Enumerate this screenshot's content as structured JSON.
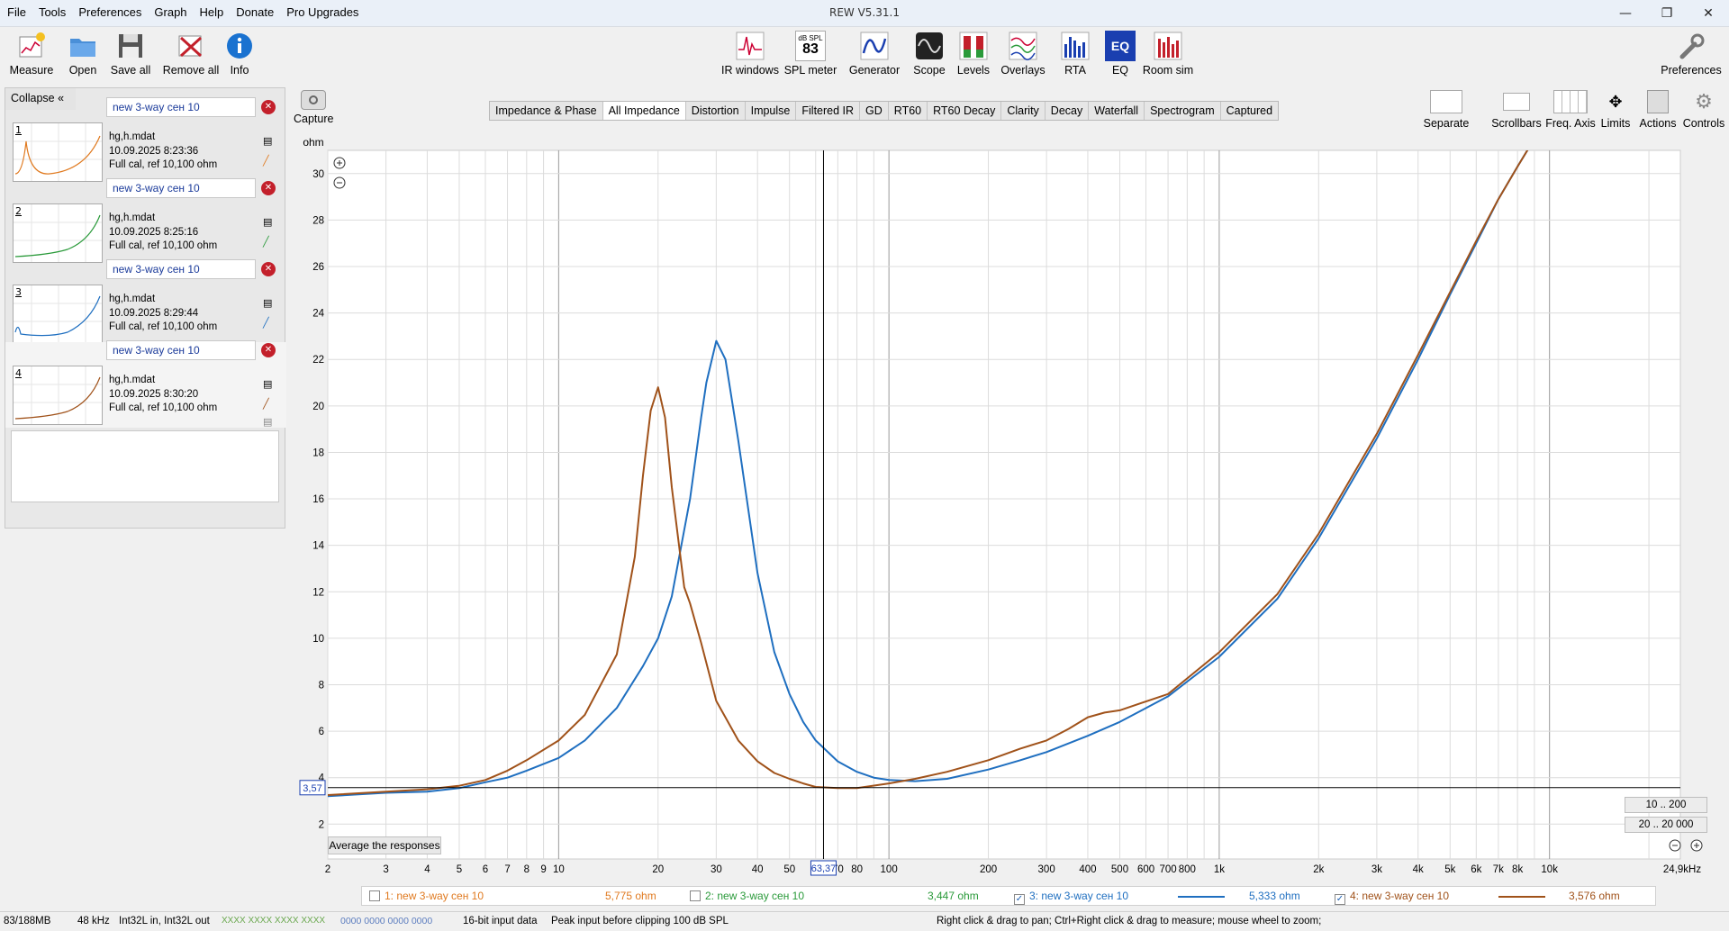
{
  "app": {
    "title": "REW V5.31.1",
    "menu": [
      "File",
      "Tools",
      "Preferences",
      "Graph",
      "Help",
      "Donate",
      "Pro Upgrades"
    ]
  },
  "toolbar_left": [
    {
      "label": "Measure",
      "icon": "measure-icon"
    },
    {
      "label": "Open",
      "icon": "folder-icon"
    },
    {
      "label": "Save all",
      "icon": "floppy-icon"
    },
    {
      "label": "Remove all",
      "icon": "remove-icon"
    },
    {
      "label": "Info",
      "icon": "info-icon"
    }
  ],
  "toolbar_center": [
    {
      "label": "IR windows",
      "icon": "ir-windows-icon"
    },
    {
      "label": "SPL meter",
      "icon": "spl-meter-icon",
      "badge_top": "dB SPL",
      "badge_value": "83"
    },
    {
      "label": "Generator",
      "icon": "generator-icon"
    },
    {
      "label": "Scope",
      "icon": "scope-icon"
    },
    {
      "label": "Levels",
      "icon": "levels-icon"
    },
    {
      "label": "Overlays",
      "icon": "overlays-icon"
    },
    {
      "label": "RTA",
      "icon": "rta-icon"
    },
    {
      "label": "EQ",
      "icon": "eq-icon"
    },
    {
      "label": "Room sim",
      "icon": "room-sim-icon"
    }
  ],
  "toolbar_right": {
    "label": "Preferences",
    "icon": "wrench-icon"
  },
  "panel": {
    "collapse_label": "Collapse",
    "measurements": [
      {
        "num": "1",
        "name": "new 3-way сен 10",
        "file": "hg,h.mdat",
        "date": "10.09.2025 8:23:36",
        "cal": "Full cal, ref 10,100 ohm",
        "color": "#e07a20",
        "thumb_x_start": "20",
        "thumb_x_end": "20,0k"
      },
      {
        "num": "2",
        "name": "new 3-way сен 10",
        "file": "hg,h.mdat",
        "date": "10.09.2025 8:25:16",
        "cal": "Full cal, ref 10,100 ohm",
        "color": "#2a9a3a",
        "thumb_x_start": "20",
        "thumb_x_end": "20,0k"
      },
      {
        "num": "3",
        "name": "new 3-way сен 10",
        "file": "hg,h.mdat",
        "date": "10.09.2025 8:29:44",
        "cal": "Full cal, ref 10,100 ohm",
        "color": "#1f6fc0",
        "thumb_x_start": "20",
        "thumb_x_end": "20,0k"
      },
      {
        "num": "4",
        "name": "new 3-way сен 10",
        "file": "hg,h.mdat",
        "date": "10.09.2025 8:30:20",
        "cal": "Full cal, ref 10,100 ohm",
        "color": "#a0521a",
        "thumb_x_start": "20",
        "thumb_x_end": "20,0k"
      }
    ]
  },
  "capture": {
    "label": "Capture"
  },
  "tabs": [
    "Impedance & Phase",
    "All Impedance",
    "Distortion",
    "Impulse",
    "Filtered IR",
    "GD",
    "RT60",
    "RT60 Decay",
    "Clarity",
    "Decay",
    "Waterfall",
    "Spectrogram",
    "Captured"
  ],
  "active_tab": "All Impedance",
  "graph_tools": [
    {
      "label": "Separate",
      "icon": "separate-icon"
    },
    {
      "label": "Scrollbars",
      "icon": "scrollbars-icon"
    },
    {
      "label": "Freq. Axis",
      "icon": "freq-axis-icon"
    },
    {
      "label": "Limits",
      "icon": "limits-icon"
    },
    {
      "label": "Actions",
      "icon": "actions-icon"
    },
    {
      "label": "Controls",
      "icon": "controls-icon"
    }
  ],
  "graph": {
    "y_unit": "ohm",
    "cursor_y_label": "3,57",
    "cursor_x_label": "63,37",
    "avg_button": "Average the responses",
    "range_buttons": [
      "10 .. 200",
      "20 .. 20 000"
    ],
    "x_end_label": "24,9kHz"
  },
  "chart_data": {
    "type": "line",
    "xscale": "log",
    "xlim": [
      2,
      24900
    ],
    "ylim": [
      0.5,
      31
    ],
    "ylabel": "ohm",
    "y_ticks": [
      2,
      4,
      6,
      8,
      10,
      12,
      14,
      16,
      18,
      20,
      22,
      24,
      26,
      28,
      30
    ],
    "x_ticks": [
      {
        "v": 2,
        "t": "2"
      },
      {
        "v": 3,
        "t": "3"
      },
      {
        "v": 4,
        "t": "4"
      },
      {
        "v": 5,
        "t": "5"
      },
      {
        "v": 6,
        "t": "6"
      },
      {
        "v": 7,
        "t": "7"
      },
      {
        "v": 8,
        "t": "8"
      },
      {
        "v": 9,
        "t": "9"
      },
      {
        "v": 10,
        "t": "10"
      },
      {
        "v": 20,
        "t": "20"
      },
      {
        "v": 30,
        "t": "30"
      },
      {
        "v": 40,
        "t": "40"
      },
      {
        "v": 50,
        "t": "50"
      },
      {
        "v": 70,
        "t": "70"
      },
      {
        "v": 80,
        "t": "80"
      },
      {
        "v": 100,
        "t": "100"
      },
      {
        "v": 200,
        "t": "200"
      },
      {
        "v": 300,
        "t": "300"
      },
      {
        "v": 400,
        "t": "400"
      },
      {
        "v": 500,
        "t": "500"
      },
      {
        "v": 600,
        "t": "600"
      },
      {
        "v": 700,
        "t": "700"
      },
      {
        "v": 800,
        "t": "800"
      },
      {
        "v": 1000,
        "t": "1k"
      },
      {
        "v": 2000,
        "t": "2k"
      },
      {
        "v": 3000,
        "t": "3k"
      },
      {
        "v": 4000,
        "t": "4k"
      },
      {
        "v": 5000,
        "t": "5k"
      },
      {
        "v": 6000,
        "t": "6k"
      },
      {
        "v": 7000,
        "t": "7k"
      },
      {
        "v": 8000,
        "t": "8k"
      },
      {
        "v": 10000,
        "t": "10k"
      }
    ],
    "cursor": {
      "x": 63.37,
      "y": 3.57
    },
    "series": [
      {
        "name": "3: new 3-way сен 10",
        "color": "#1f6fc0",
        "x": [
          2,
          3,
          4,
          5,
          6,
          7,
          8,
          10,
          12,
          15,
          18,
          20,
          22,
          25,
          27,
          28,
          30,
          32,
          35,
          40,
          45,
          50,
          55,
          60,
          70,
          80,
          90,
          100,
          120,
          150,
          200,
          250,
          300,
          400,
          500,
          700,
          1000,
          1500,
          2000,
          3000,
          4000,
          5000,
          6000,
          7000,
          8000,
          9000,
          10000
        ],
        "y": [
          3.2,
          3.35,
          3.4,
          3.55,
          3.8,
          4.0,
          4.3,
          4.85,
          5.6,
          7.0,
          8.8,
          10.0,
          11.8,
          16.0,
          19.5,
          21.0,
          22.8,
          22.0,
          18.5,
          12.8,
          9.4,
          7.6,
          6.4,
          5.6,
          4.7,
          4.25,
          4.0,
          3.9,
          3.85,
          3.95,
          4.35,
          4.75,
          5.1,
          5.8,
          6.4,
          7.5,
          9.2,
          11.7,
          14.3,
          18.6,
          22.0,
          24.8,
          27.0,
          28.9,
          30.3,
          31.5,
          32.5
        ]
      },
      {
        "name": "4: new 3-way сен 10",
        "color": "#a0521a",
        "x": [
          2,
          3,
          4,
          5,
          6,
          7,
          8,
          10,
          12,
          15,
          17,
          18,
          19,
          20,
          21,
          22,
          24,
          25,
          27,
          30,
          35,
          40,
          45,
          50,
          55,
          60,
          70,
          80,
          100,
          120,
          150,
          200,
          250,
          300,
          350,
          400,
          450,
          500,
          700,
          1000,
          1500,
          2000,
          3000,
          4000,
          5000,
          6000,
          7000,
          8000,
          9000,
          10000
        ],
        "y": [
          3.25,
          3.4,
          3.5,
          3.65,
          3.9,
          4.3,
          4.75,
          5.6,
          6.7,
          9.3,
          13.5,
          17.0,
          19.8,
          20.8,
          19.5,
          16.5,
          12.2,
          11.5,
          9.8,
          7.3,
          5.6,
          4.7,
          4.2,
          3.95,
          3.75,
          3.6,
          3.55,
          3.55,
          3.75,
          3.95,
          4.25,
          4.75,
          5.25,
          5.6,
          6.1,
          6.6,
          6.8,
          6.9,
          7.6,
          9.4,
          11.9,
          14.5,
          18.8,
          22.2,
          24.9,
          27.1,
          28.9,
          30.3,
          31.5,
          32.5
        ]
      }
    ]
  },
  "legend": [
    {
      "checked": false,
      "name": "1: new 3-way сен 10",
      "value": "5,775 ohm",
      "color": "#e07a20",
      "show_line": false
    },
    {
      "checked": false,
      "name": "2: new 3-way сен 10",
      "value": "3,447 ohm",
      "color": "#2a9a3a",
      "show_line": false
    },
    {
      "checked": true,
      "name": "3: new 3-way сен 10",
      "value": "5,333 ohm",
      "color": "#1f6fc0",
      "show_line": true
    },
    {
      "checked": true,
      "name": "4: new 3-way сен 10",
      "value": "3,576 ohm",
      "color": "#a0521a",
      "show_line": true
    }
  ],
  "status": {
    "memory": "83/188MB",
    "rate": "48 kHz",
    "io": "Int32L in, Int32L out",
    "meter_a": "XXXX XXXX  XXXX XXXX",
    "meter_b": "0000 0000  0000 0000",
    "bits": "16-bit input data",
    "peak": "Peak input before clipping 100 dB SPL",
    "hint": "Right click & drag to pan; Ctrl+Right click & drag to measure; mouse wheel to zoom;"
  }
}
